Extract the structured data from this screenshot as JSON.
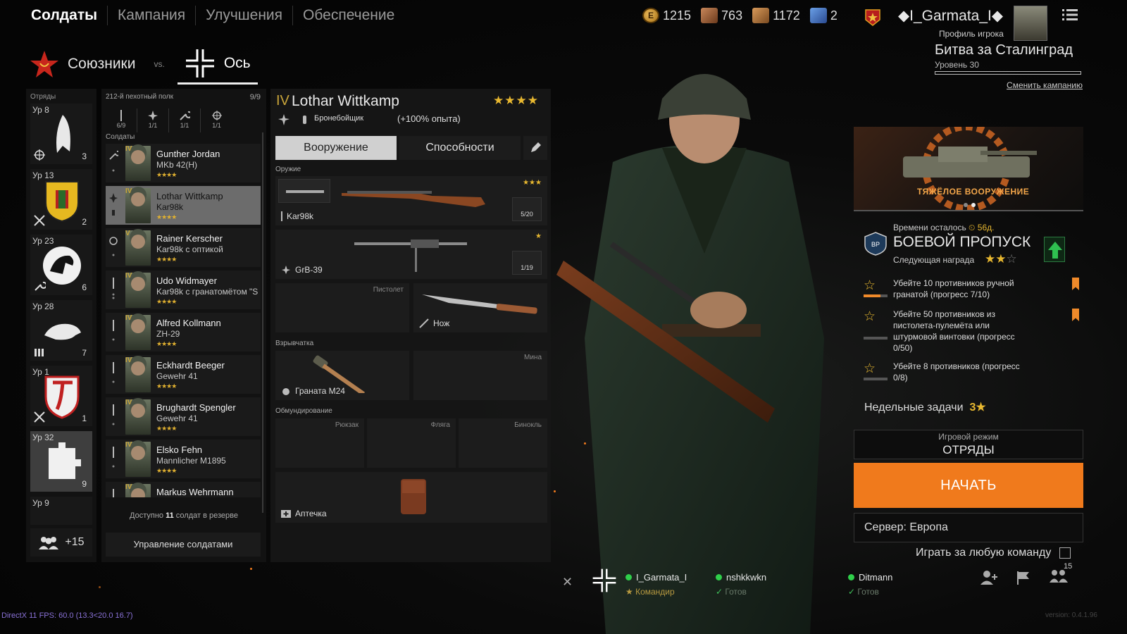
{
  "nav": {
    "tabs": [
      "Солдаты",
      "Кампания",
      "Улучшения",
      "Обеспечение"
    ],
    "active": 0
  },
  "currencies": [
    {
      "icon": "coin-icon",
      "value": "1215"
    },
    {
      "icon": "orders-icon",
      "value": "763"
    },
    {
      "icon": "tickets-icon",
      "value": "1172"
    },
    {
      "icon": "cards-icon",
      "value": "2"
    }
  ],
  "player": {
    "name": "◆I_Garmata_I◆",
    "profile_label": "Профиль игрока"
  },
  "faction": {
    "allied": "Союзники",
    "vs": "vs.",
    "axis": "Ось"
  },
  "campaign": {
    "title": "Битва за Сталинград",
    "level": "Уровень 30",
    "change": "Сменить кампанию"
  },
  "squads": {
    "header": "Отряды",
    "items": [
      {
        "level": "Ур 8",
        "count": "3"
      },
      {
        "level": "Ур 13",
        "count": "2"
      },
      {
        "level": "Ур 23",
        "count": "6"
      },
      {
        "level": "Ур 28",
        "count": "7"
      },
      {
        "level": "Ур 1",
        "count": "1"
      },
      {
        "level": "Ур 32",
        "count": "9"
      },
      {
        "level": "Ур 9",
        "count": ""
      }
    ],
    "more": "+15"
  },
  "soldiers": {
    "regiment": "212-й пехотный полк",
    "regiment_count": "9/9",
    "slots": [
      "6/9",
      "1/1",
      "1/1",
      "1/1"
    ],
    "header": "Солдаты",
    "list": [
      {
        "rank": "IV",
        "name": "Gunther Jordan",
        "weapon": "MKb 42(H)",
        "stars": "★★★★"
      },
      {
        "rank": "IV",
        "name": "Lothar Wittkamp",
        "weapon": "Kar98k",
        "stars": "★★★★"
      },
      {
        "rank": "V",
        "name": "Rainer Kerscher",
        "weapon": "Kar98k с оптикой",
        "stars": "★★★★"
      },
      {
        "rank": "IV",
        "name": "Udo Widmayer",
        "weapon": "Kar98k с гранатомётом \"S",
        "stars": "★★★★"
      },
      {
        "rank": "IV",
        "name": "Alfred Kollmann",
        "weapon": "ZH-29",
        "stars": "★★★★"
      },
      {
        "rank": "IV",
        "name": "Eckhardt Beeger",
        "weapon": "Gewehr 41",
        "stars": "★★★★"
      },
      {
        "rank": "IV",
        "name": "Brughardt Spengler",
        "weapon": "Gewehr 41",
        "stars": "★★★★"
      },
      {
        "rank": "IV",
        "name": "Elsko Fehn",
        "weapon": "Mannlicher M1895",
        "stars": "★★★★"
      },
      {
        "rank": "IV",
        "name": "Markus Wehrmann",
        "weapon": "",
        "stars": ""
      }
    ],
    "reserve_prefix": "Доступно ",
    "reserve_count": "11",
    "reserve_suffix": " солдат в резерве",
    "manage": "Управление солдатами"
  },
  "selected": {
    "rank": "IV",
    "name": "Lothar Wittkamp",
    "stars": "★★★★",
    "class": "Бронебойщик",
    "bonus": "(+100% опыта)",
    "tabs": [
      "Вооружение",
      "Способности"
    ],
    "sections": {
      "weapons": "Оружие",
      "explosives": "Взрывчатка",
      "uniform": "Обмундирование"
    },
    "primary": {
      "name": "Kar98k",
      "ammo": "5/20",
      "stars": "★★★"
    },
    "secondary": {
      "name": "GrB-39",
      "ammo": "1/19",
      "stars": "★"
    },
    "pistol_slot": "Пистолет",
    "melee": "Нож",
    "grenade": "Граната М24",
    "mine_slot": "Мина",
    "backpack_slot": "Рюкзак",
    "flask_slot": "Фляга",
    "binoculars_slot": "Бинокль",
    "medkit": "Аптечка"
  },
  "battlepass": {
    "banner": "ТЯЖЁЛОЕ ВООРУЖЕНИЕ",
    "time_label": "Времени осталось ",
    "time_value": "56д.",
    "title": "БОЕВОЙ ПРОПУСК",
    "next_reward": "Следующая награда",
    "tasks": [
      {
        "text": "Убейте 10 противников ручной гранатой (прогресс 7/10)",
        "progress": 0.7,
        "bookmark": true
      },
      {
        "text": "Убейте 50 противников из пистолета-пулемёта или штурмовой винтовки (прогресс 0/50)",
        "progress": 0,
        "bookmark": true
      },
      {
        "text": "Убейте 8 противников (прогресс 0/8)",
        "progress": 0,
        "bookmark": false
      }
    ],
    "weekly_label": "Недельные задачи",
    "weekly_value": "3★"
  },
  "mode": {
    "label": "Игровой режим",
    "value": "ОТРЯДЫ"
  },
  "start": "НАЧАТЬ",
  "server": "Сервер: Европа",
  "any_team": "Играть за любую команду",
  "squadmates": [
    {
      "name": "I_Garmata_I",
      "status": "Командир"
    },
    {
      "name": "nshkkwkn",
      "status": "Готов"
    },
    {
      "name": "Ditmann",
      "status": "Готов"
    }
  ],
  "friends_count": "15",
  "fps": "DirectX 11 FPS: 60.0 (13.3<20.0 16.7)",
  "version": "version: 0.4.1.96",
  "colors": {
    "accent": "#f07a1c",
    "gold": "#e8b830",
    "online": "#2fcf4a"
  }
}
